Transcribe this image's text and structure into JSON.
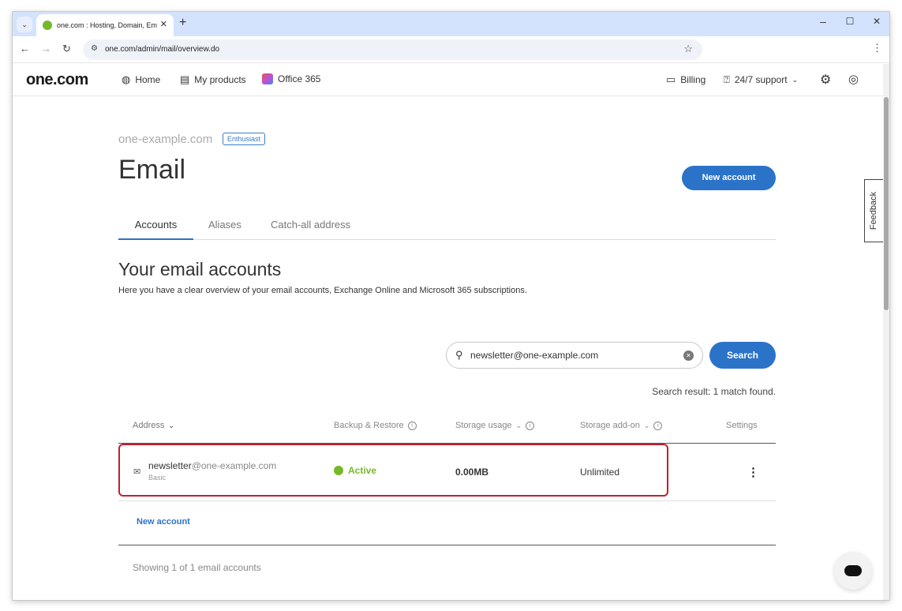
{
  "browser": {
    "tab_title": "one.com : Hosting, Domain, Em",
    "url": "one.com/admin/mail/overview.do",
    "win_min": "–",
    "win_max": "☐",
    "win_close": "✕"
  },
  "header": {
    "logo": "one.com",
    "nav": {
      "home": "Home",
      "products": "My products",
      "office": "Office 365",
      "billing": "Billing",
      "support": "24/7 support"
    }
  },
  "feedback": "Feedback",
  "page": {
    "domain": "one-example.com",
    "plan_badge": "Enthusiast",
    "title": "Email",
    "new_account_button": "New account",
    "tabs": [
      "Accounts",
      "Aliases",
      "Catch-all address"
    ],
    "section_title": "Your email accounts",
    "section_desc": "Here you have a clear overview of your email accounts, Exchange Online and Microsoft 365 subscriptions.",
    "search": {
      "value": "newsletter@one-example.com",
      "button": "Search",
      "result": "Search result: 1 match found."
    },
    "table": {
      "headers": {
        "address": "Address",
        "backup": "Backup & Restore",
        "storage": "Storage usage",
        "addon": "Storage add-on",
        "settings": "Settings"
      },
      "rows": [
        {
          "user": "newsletter",
          "domain": "@one-example.com",
          "plan": "Basic",
          "status": "Active",
          "storage": "0.00MB",
          "addon": "Unlimited"
        }
      ]
    },
    "new_account_link": "New account",
    "showing": "Showing 1 of 1 email accounts"
  },
  "colors": {
    "accent": "#2b73c9",
    "active": "#76b82a",
    "highlight": "#c0202f"
  }
}
